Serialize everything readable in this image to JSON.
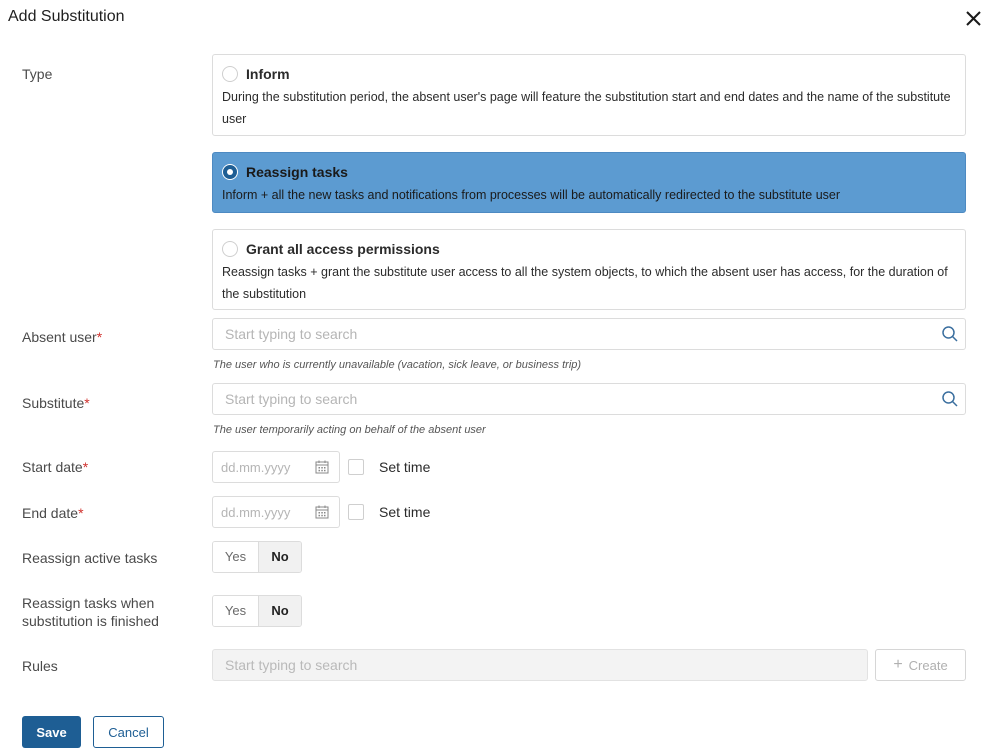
{
  "dialog": {
    "title": "Add Substitution",
    "close_icon": "close-icon"
  },
  "type": {
    "label": "Type",
    "selected": "reassign",
    "options": [
      {
        "id": "inform",
        "title": "Inform",
        "description": "During the substitution period, the absent user's page will feature the substitution start and end dates and the name of the substitute user"
      },
      {
        "id": "reassign",
        "title": "Reassign tasks",
        "description": "Inform + all the new tasks and notifications from processes will be automatically redirected to the substitute user"
      },
      {
        "id": "grant",
        "title": "Grant all access permissions",
        "description": "Reassign tasks + grant the substitute user access to all the system objects, to which the absent user has access, for the duration of the substitution"
      }
    ]
  },
  "absent_user": {
    "label": "Absent user",
    "required_mark": "*",
    "placeholder": "Start typing to search",
    "value": "",
    "hint": "The user who is currently unavailable (vacation, sick leave, or business trip)"
  },
  "substitute": {
    "label": "Substitute",
    "required_mark": "*",
    "placeholder": "Start typing to search",
    "value": "",
    "hint": "The user temporarily acting on behalf of the absent user"
  },
  "start_date": {
    "label": "Start date",
    "required_mark": "*",
    "placeholder": "dd.mm.yyyy",
    "set_time_label": "Set time",
    "set_time_checked": false
  },
  "end_date": {
    "label": "End date",
    "required_mark": "*",
    "placeholder": "dd.mm.yyyy",
    "set_time_label": "Set time",
    "set_time_checked": false
  },
  "reassign_active": {
    "label": "Reassign active tasks",
    "yes_label": "Yes",
    "no_label": "No",
    "selected": "No"
  },
  "reassign_finished": {
    "label_line1": "Reassign tasks when",
    "label_line2": "substitution is finished",
    "yes_label": "Yes",
    "no_label": "No",
    "selected": "No"
  },
  "rules": {
    "label": "Rules",
    "placeholder": "Start typing to search",
    "create_label": "Create"
  },
  "footer": {
    "save_label": "Save",
    "cancel_label": "Cancel"
  },
  "colors": {
    "primary": "#1e5e94",
    "selected_card": "#5c9bd1",
    "required": "#d0312d"
  }
}
